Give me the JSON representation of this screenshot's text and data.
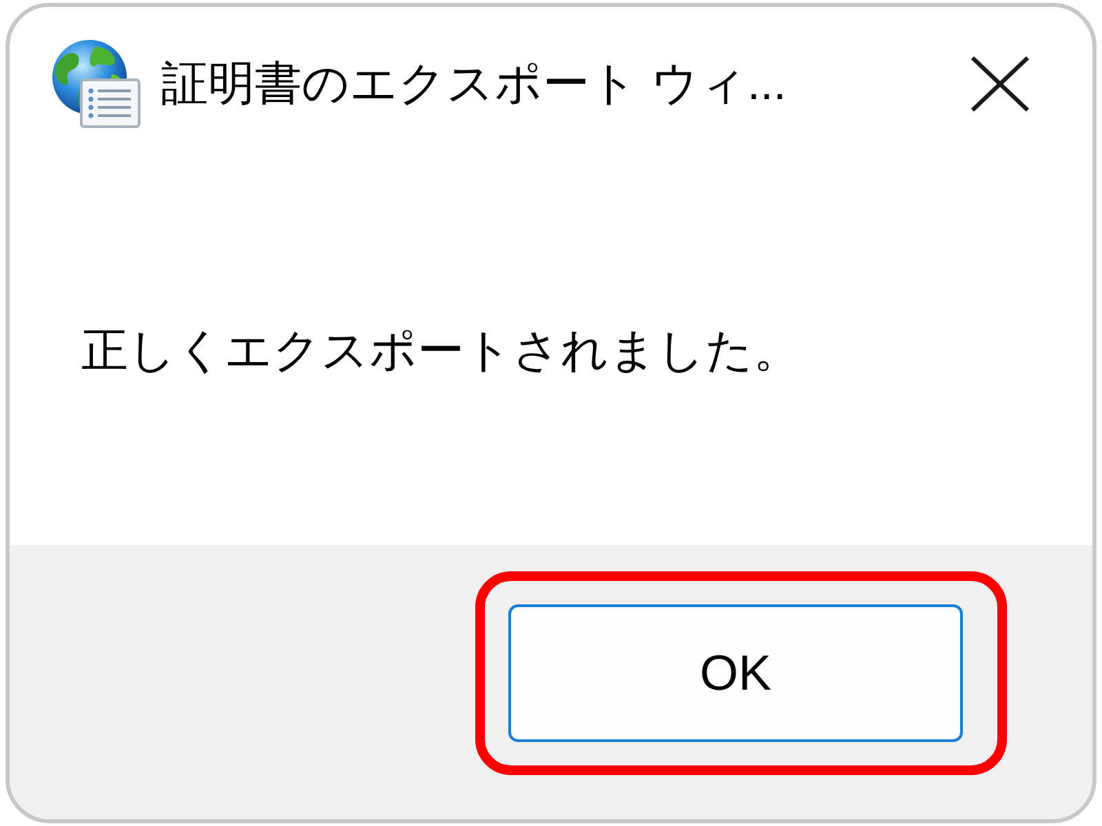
{
  "window": {
    "title": "証明書のエクスポート ウィ..."
  },
  "message": "正しくエクスポートされました。",
  "buttons": [
    {
      "label": "OK",
      "default": true,
      "highlighted": true
    }
  ]
}
